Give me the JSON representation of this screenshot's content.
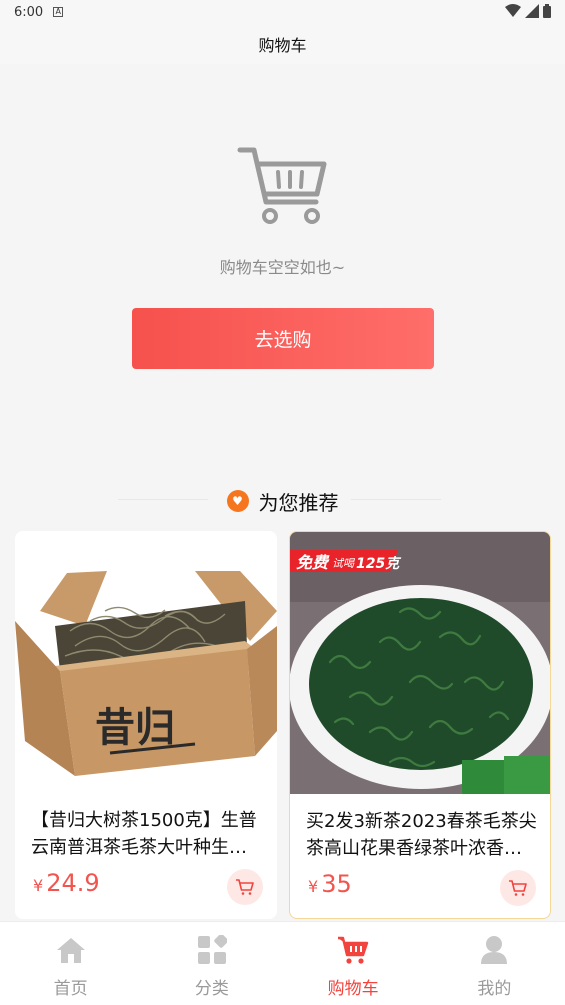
{
  "status_bar": {
    "time": "6:00",
    "notif_glyph": "A"
  },
  "nav": {
    "title": "购物车"
  },
  "empty_cart": {
    "message": "购物车空空如也~",
    "button_label": "去选购"
  },
  "recommend": {
    "heading": "为您推荐",
    "products": [
      {
        "title": "【昔归大树茶1500克】生普云南普洱茶毛茶大叶种生…",
        "currency": "¥",
        "price": "24.9",
        "box_text": "昔归"
      },
      {
        "title": "买2发3新茶2023春茶毛茶尖茶高山花果香绿茶叶浓香…",
        "currency": "¥",
        "price": "35",
        "promo_main": "免费",
        "promo_sub": "试喝",
        "promo_qty": "125克"
      }
    ]
  },
  "tabbar": {
    "tabs": [
      {
        "label": "首页",
        "icon": "home-icon"
      },
      {
        "label": "分类",
        "icon": "category-icon"
      },
      {
        "label": "购物车",
        "icon": "cart-icon",
        "active": true
      },
      {
        "label": "我的",
        "icon": "user-icon"
      }
    ]
  },
  "colors": {
    "accent": "#f2443f",
    "button_start": "#f6514d",
    "button_end": "#ff6e6a",
    "heart": "#f6761f"
  }
}
